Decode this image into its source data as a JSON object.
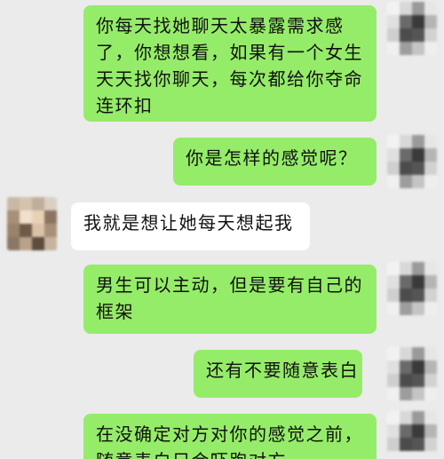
{
  "messages": [
    {
      "side": "right",
      "text": "你每天找她聊天太暴露需求感了，你想想看，如果有一个女生天天找你聊天，每次都给你夺命连环扣"
    },
    {
      "side": "right",
      "text": "你是怎样的感觉呢？"
    },
    {
      "side": "left",
      "text": "我就是想让她每天想起我"
    },
    {
      "side": "right",
      "text": "男生可以主动，但是要有自己的框架"
    },
    {
      "side": "right",
      "text": "还有不要随意表白"
    },
    {
      "side": "right",
      "text": "在没确定对方对你的感觉之前，随意表白只会吓跑对方"
    }
  ],
  "colors": {
    "background": "#ebebeb",
    "bubble_self": "#95ec69",
    "bubble_other": "#ffffff"
  }
}
